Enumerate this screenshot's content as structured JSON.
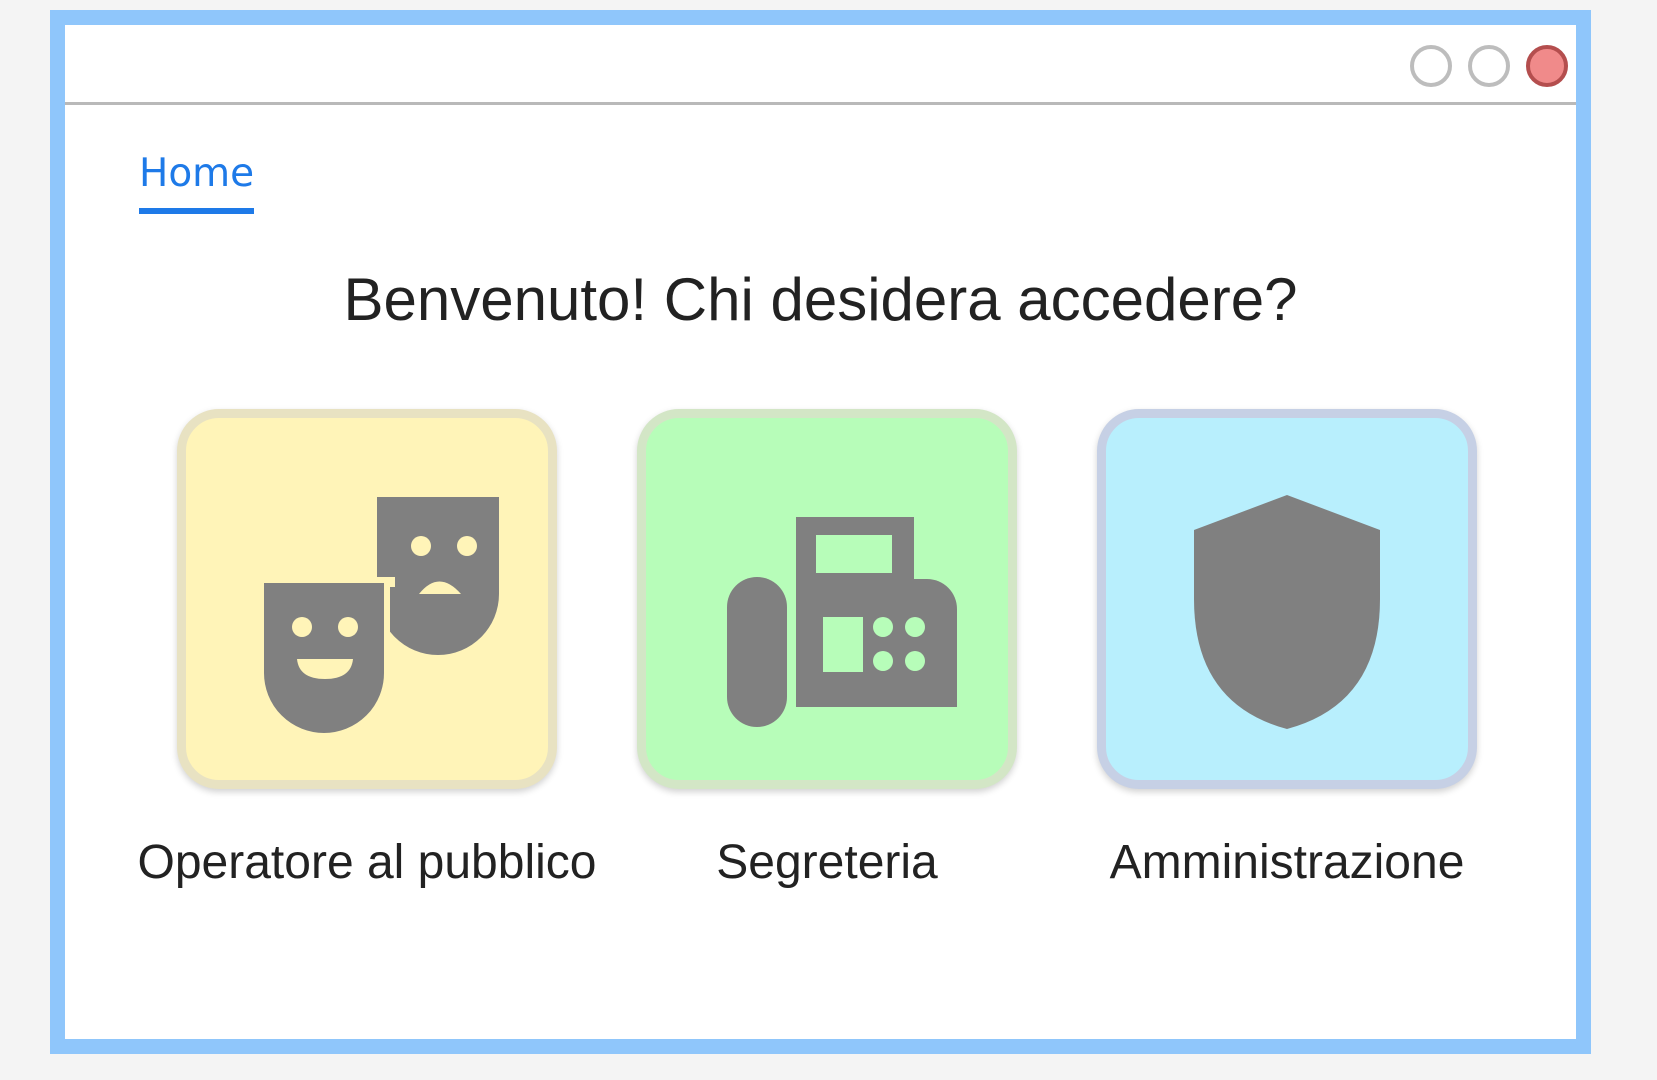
{
  "window": {
    "controls": [
      "minimize",
      "maximize",
      "close"
    ],
    "colors": {
      "frame": "#8fc6fb",
      "close": "#f08a8a"
    }
  },
  "nav": {
    "tabs": [
      {
        "label": "Home",
        "active": true
      }
    ],
    "accent": "#1e7ae8"
  },
  "main": {
    "heading": "Benvenuto! Chi desidera accedere?",
    "options": [
      {
        "label": "Operatore al pubblico",
        "icon": "theater-masks-icon",
        "color": "#fff4b8"
      },
      {
        "label": "Segreteria",
        "icon": "fax-machine-icon",
        "color": "#b7fdb9"
      },
      {
        "label": "Amministrazione",
        "icon": "shield-icon",
        "color": "#b8effd"
      }
    ]
  }
}
